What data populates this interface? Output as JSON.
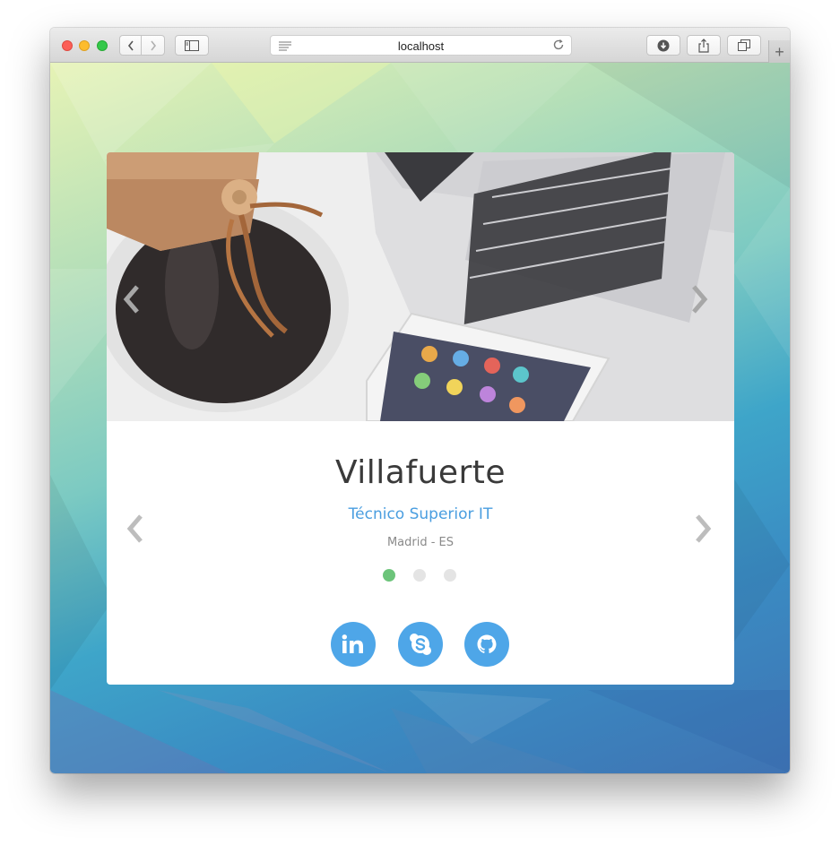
{
  "browser": {
    "url": "localhost",
    "new_tab_label": "+"
  },
  "profile": {
    "name": "Villafuerte",
    "role": "Técnico Superior IT",
    "location": "Madrid - ES"
  },
  "slider": {
    "dots": [
      {
        "active": true
      },
      {
        "active": false
      },
      {
        "active": false
      }
    ]
  },
  "social_links": [
    {
      "icon": "linkedin-icon"
    },
    {
      "icon": "skype-icon"
    },
    {
      "icon": "github-icon"
    }
  ],
  "colors": {
    "accent": "#4ea6e8",
    "active_dot": "#6cc47a",
    "inactive_dot": "#e4e4e4",
    "name_text": "#3a3a3a",
    "role_text": "#4a9ee0"
  }
}
